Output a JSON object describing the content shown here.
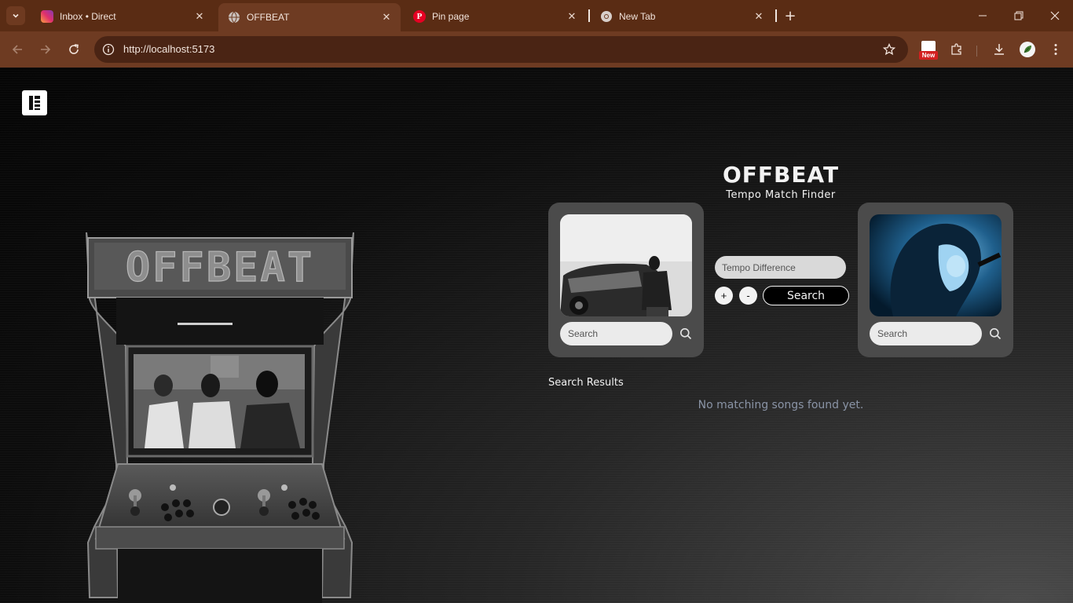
{
  "browser": {
    "tabs": [
      {
        "title": "Inbox • Direct",
        "icon": "instagram-icon",
        "active": false
      },
      {
        "title": "OFFBEAT",
        "icon": "globe-icon",
        "active": true
      },
      {
        "title": "Pin page",
        "icon": "pinterest-icon",
        "active": false
      },
      {
        "title": "New Tab",
        "icon": "chrome-icon",
        "active": false
      }
    ],
    "url": "http://localhost:5173",
    "extension_badge": "New",
    "colors": {
      "tabbar": "#5a2c14",
      "toolbar": "#6e3b22",
      "omnibox": "#4a2414"
    }
  },
  "app": {
    "arcade_marquee": "OFFBEAT",
    "title": "OFFBEAT",
    "subtitle": "Tempo Match Finder",
    "left_card": {
      "search_placeholder": "Search"
    },
    "right_card": {
      "search_placeholder": "Search"
    },
    "tempo": {
      "placeholder": "Tempo Difference",
      "plus": "+",
      "minus": "-"
    },
    "search_button": "Search",
    "results": {
      "label": "Search Results",
      "empty": "No matching songs found yet."
    }
  }
}
